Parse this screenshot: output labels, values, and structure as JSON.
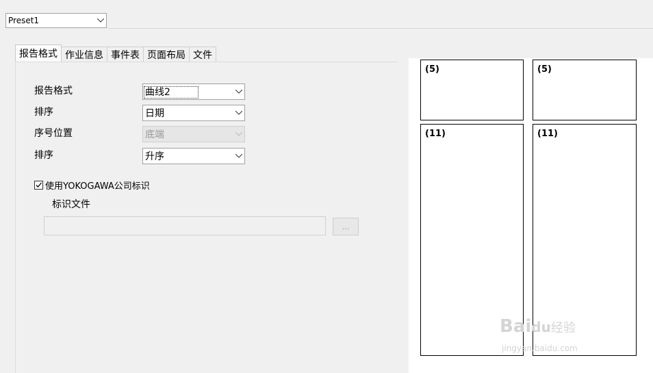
{
  "preset": {
    "value": "Preset1"
  },
  "tabs": [
    {
      "label": "报告格式",
      "active": true
    },
    {
      "label": "作业信息",
      "active": false
    },
    {
      "label": "事件表",
      "active": false
    },
    {
      "label": "页面布局",
      "active": false
    },
    {
      "label": "文件",
      "active": false
    }
  ],
  "form": {
    "report_format_label": "报告格式",
    "report_format_value": "曲线2",
    "sort1_label": "排序",
    "sort1_value": "日期",
    "seq_pos_label": "序号位置",
    "seq_pos_value": "底端",
    "sort2_label": "排序",
    "sort2_value": "升序",
    "use_logo_label": "使用YOKOGAWA公司标识",
    "use_logo_checked": true,
    "logo_file_label": "标识文件",
    "logo_file_value": "",
    "browse_label": "..."
  },
  "preview": {
    "cells": [
      "(5)",
      "(5)",
      "(11)",
      "(11)"
    ]
  },
  "watermark": {
    "brand": "Bai",
    "brand2": "du",
    "suffix": "经验",
    "url": "jingyan.baidu.com"
  }
}
